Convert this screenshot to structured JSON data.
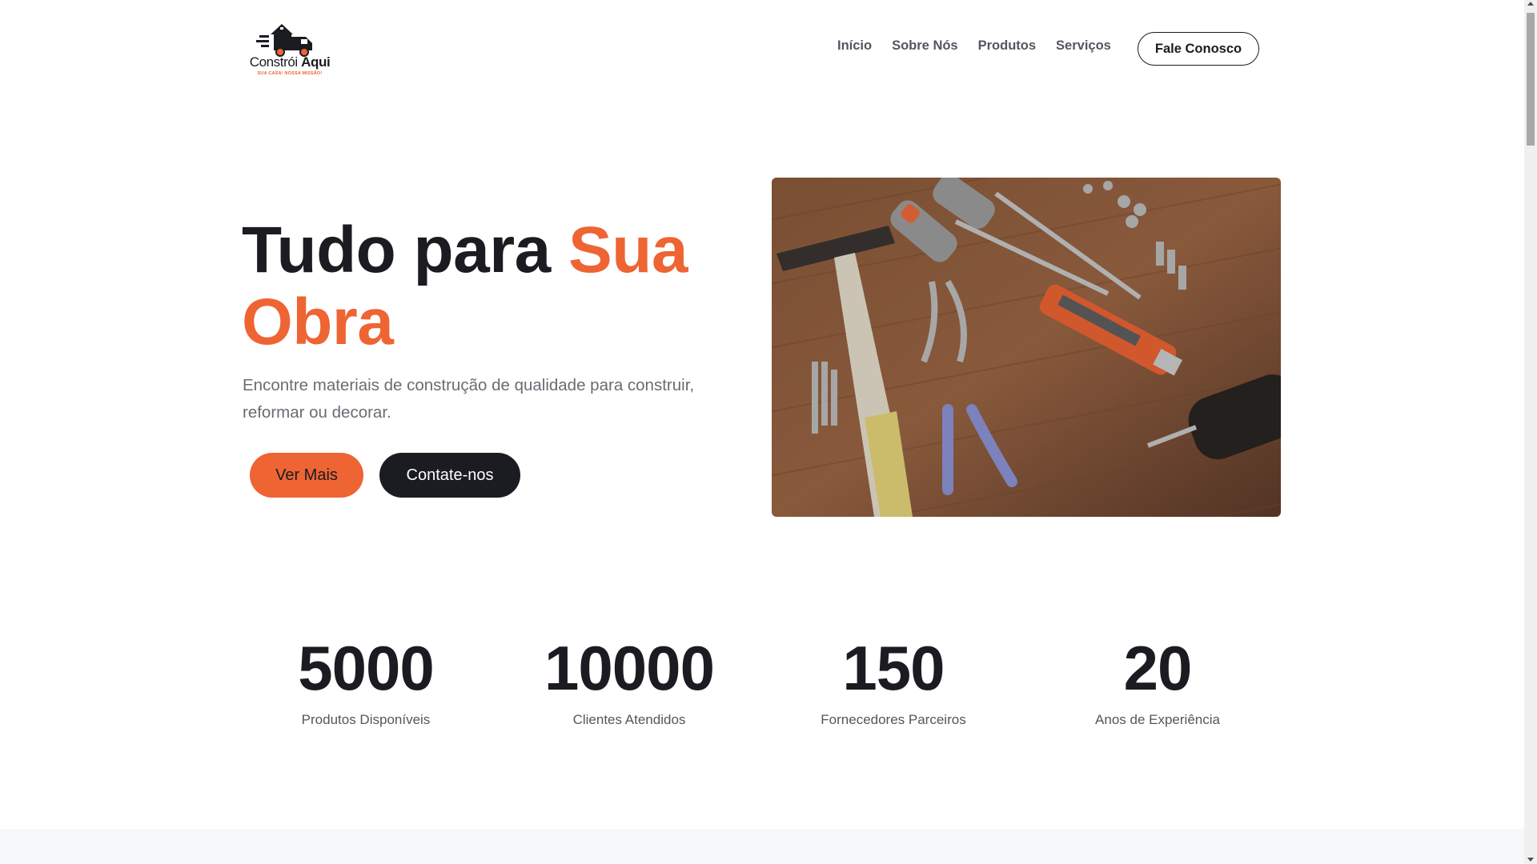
{
  "brand": {
    "name_part1": "Constrói",
    "name_part2": "Aqui",
    "tagline": "SUA CASA! NOSSA MISSÃO!",
    "logo_icon": "house-truck-icon"
  },
  "nav": {
    "items": [
      "Início",
      "Sobre Nós",
      "Produtos",
      "Serviços"
    ],
    "cta_label": "Fale Conosco"
  },
  "hero": {
    "title_dark": "Tudo para ",
    "title_accent": "Sua Obra",
    "subtitle": "Encontre materiais de construção de qualidade para construir, reformar ou decorar.",
    "primary_button": "Ver Mais",
    "secondary_button": "Contate-nos",
    "image_subject": "tools-on-wood-photo"
  },
  "stats": [
    {
      "value": "5000",
      "label": "Produtos Disponíveis"
    },
    {
      "value": "10000",
      "label": "Clientes Atendidos"
    },
    {
      "value": "150",
      "label": "Fornecedores Parceiros"
    },
    {
      "value": "20",
      "label": "Anos de Experiência"
    }
  ],
  "colors": {
    "accent": "#ee6433",
    "dark": "#1b1b22",
    "muted_text": "#6b6b74",
    "bottom_band": "#f7f8fb"
  }
}
